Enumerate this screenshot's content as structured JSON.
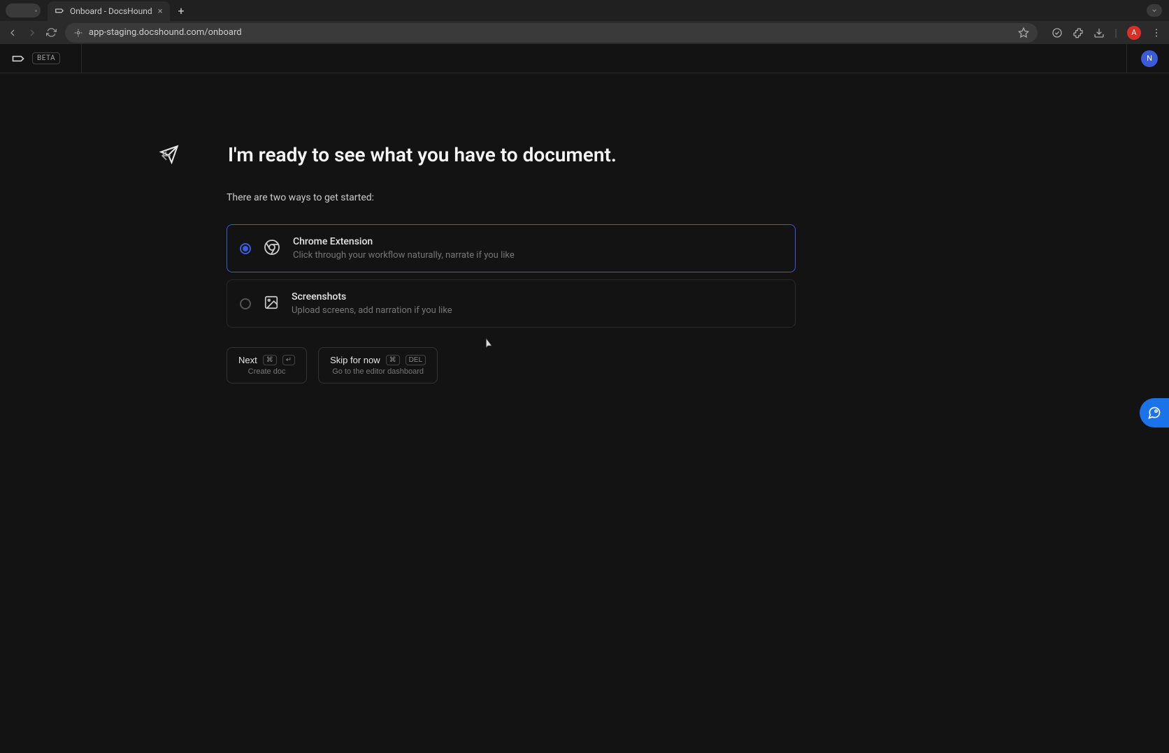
{
  "browser": {
    "tab_title": "Onboard - DocsHound",
    "url": "app-staging.docshound.com/onboard",
    "profile_initial": "A"
  },
  "header": {
    "badge": "BETA",
    "user_initial": "N"
  },
  "main": {
    "title": "I'm ready to see what you have to document.",
    "subtitle": "There are two ways to get started:",
    "options": [
      {
        "title": "Chrome Extension",
        "desc": "Click through your workflow naturally, narrate if you like",
        "selected": true
      },
      {
        "title": "Screenshots",
        "desc": "Upload screens, add narration if you like",
        "selected": false
      }
    ],
    "actions": {
      "next": {
        "label": "Next",
        "kbd1": "⌘",
        "kbd2": "↵",
        "sub": "Create doc"
      },
      "skip": {
        "label": "Skip for now",
        "kbd1": "⌘",
        "kbd2": "DEL",
        "sub": "Go to the editor dashboard"
      }
    }
  }
}
